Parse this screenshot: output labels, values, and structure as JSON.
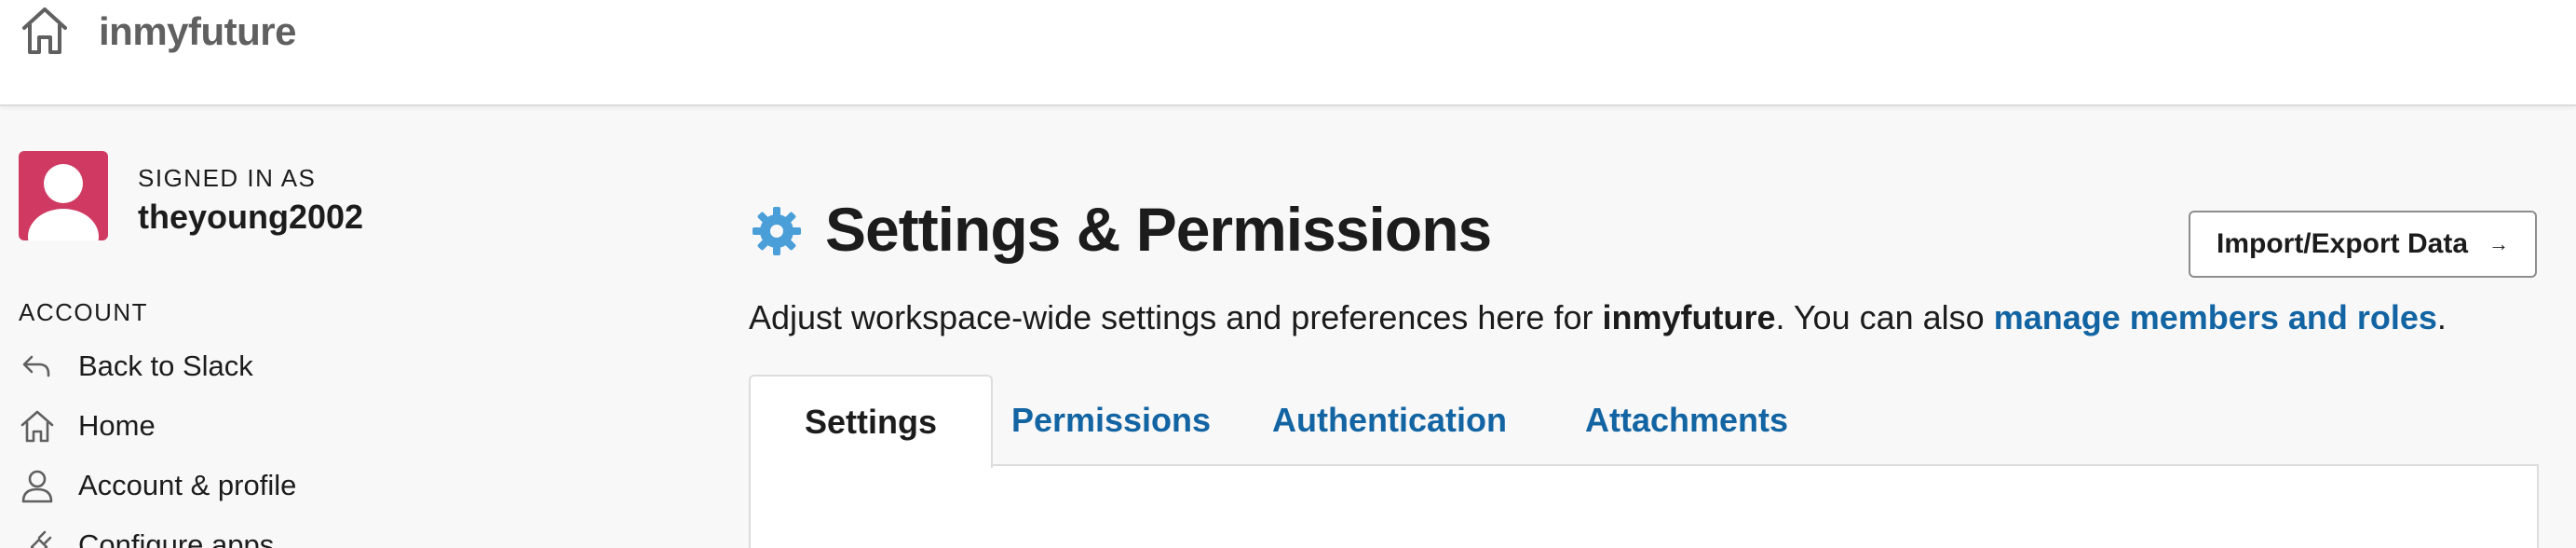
{
  "header": {
    "workspace_name": "inmyfuture",
    "home_icon": "home-icon"
  },
  "sidebar": {
    "signed_in_label": "SIGNED IN AS",
    "username": "theyoung2002",
    "avatar_color": "#d03a62",
    "section_title": "ACCOUNT",
    "items": [
      {
        "label": "Back to Slack",
        "icon": "back-arrow-icon"
      },
      {
        "label": "Home",
        "icon": "home-icon"
      },
      {
        "label": "Account & profile",
        "icon": "person-icon"
      },
      {
        "label": "Configure apps",
        "icon": "plug-icon"
      }
    ]
  },
  "main": {
    "title": "Settings & Permissions",
    "title_icon": "gear-icon",
    "description": {
      "prefix": "Adjust workspace-wide settings and preferences here for ",
      "workspace": "inmyfuture",
      "middle": ". You can also ",
      "link": "manage members and roles",
      "suffix": "."
    },
    "import_button": {
      "label": "Import/Export Data",
      "arrow": "→"
    },
    "tabs": [
      {
        "label": "Settings",
        "active": true
      },
      {
        "label": "Permissions",
        "active": false
      },
      {
        "label": "Authentication",
        "active": false
      },
      {
        "label": "Attachments",
        "active": false
      }
    ]
  },
  "colors": {
    "accent_link": "#1264a3",
    "gear": "#4a9fd8",
    "text": "#1d1c1d",
    "background": "#f8f8f8"
  }
}
